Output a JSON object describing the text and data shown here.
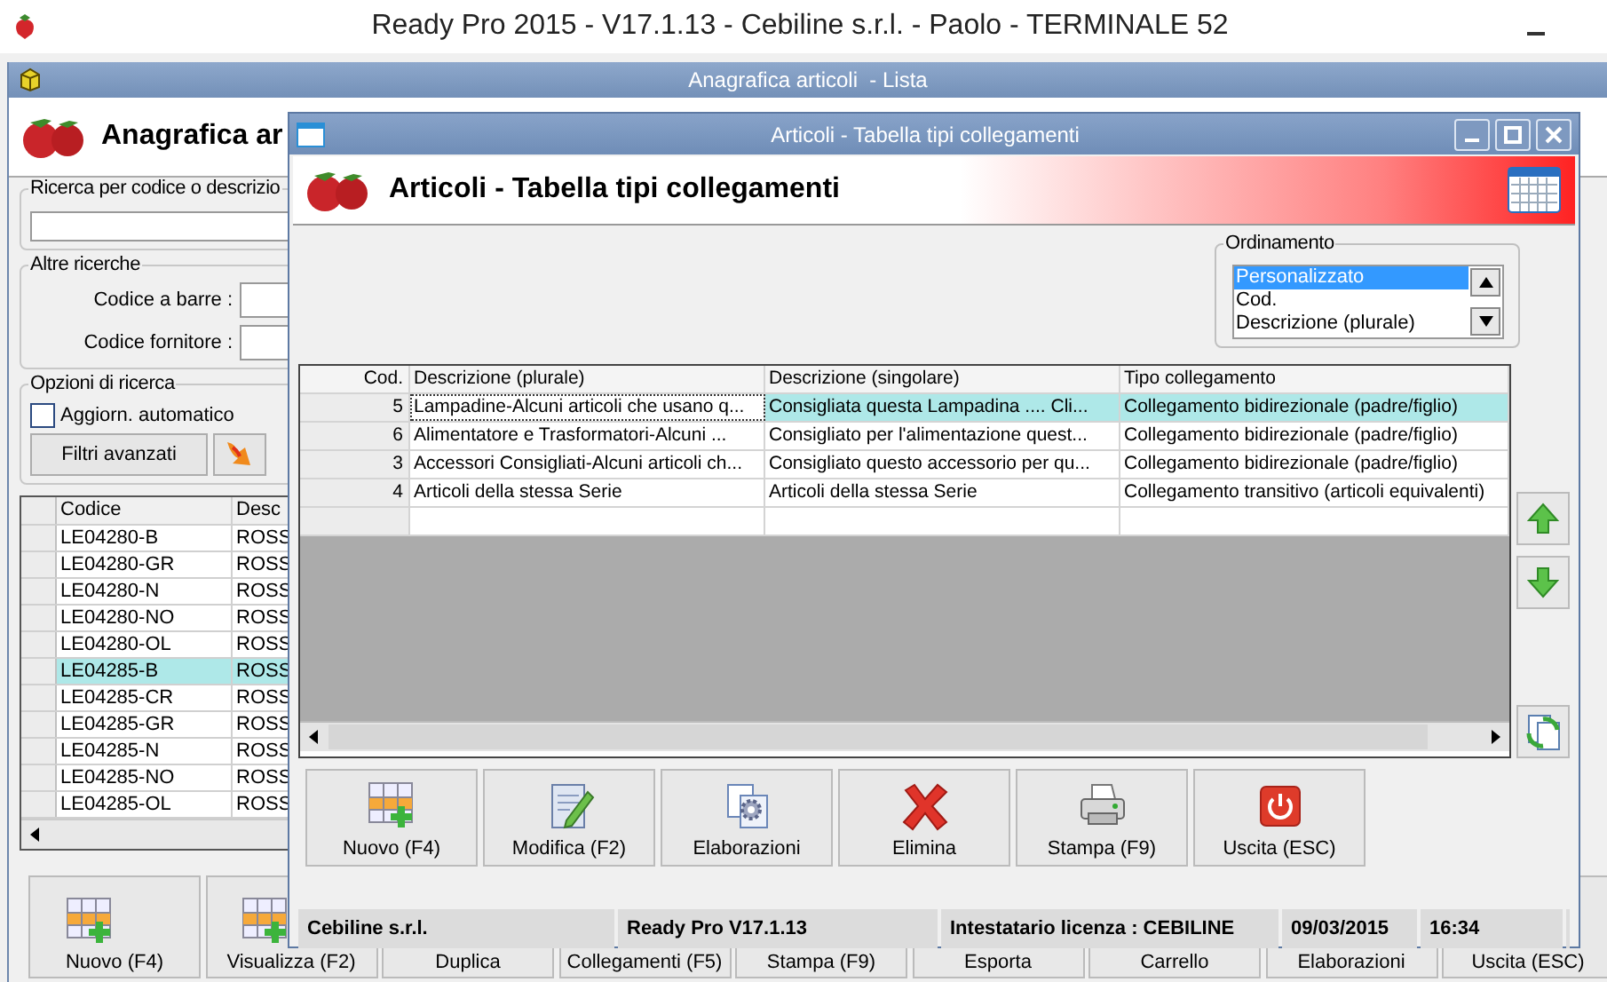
{
  "app_title": "Ready Pro 2015 - V17.1.13 - Cebiline s.r.l. - Paolo - TERMINALE 52",
  "list_window": {
    "title": "Anagrafica articoli  - Lista",
    "header": "Anagrafica ar",
    "search_group": "Ricerca per codice o descrizio",
    "other_group": "Altre ricerche",
    "other_fields": [
      {
        "label": "Codice a barre :"
      },
      {
        "label": "Codice fornitore :"
      }
    ],
    "options_group": "Opzioni di ricerca",
    "auto_update": {
      "label": "Aggiorn. automatico",
      "checked": false
    },
    "filter_button": "Filtri avanzati",
    "grid": {
      "columns": [
        "Codice",
        "Desc"
      ],
      "rows": [
        {
          "code": "LE04280-B",
          "desc": "ROSS",
          "selected": false
        },
        {
          "code": "LE04280-GR",
          "desc": "ROSS",
          "selected": false
        },
        {
          "code": "LE04280-N",
          "desc": "ROSS",
          "selected": false
        },
        {
          "code": "LE04280-NO",
          "desc": "ROSS",
          "selected": false
        },
        {
          "code": "LE04280-OL",
          "desc": "ROSS",
          "selected": false
        },
        {
          "code": "LE04285-B",
          "desc": "ROSS",
          "selected": true
        },
        {
          "code": "LE04285-CR",
          "desc": "ROSS",
          "selected": false
        },
        {
          "code": "LE04285-GR",
          "desc": "ROSS",
          "selected": false
        },
        {
          "code": "LE04285-N",
          "desc": "ROSS",
          "selected": false
        },
        {
          "code": "LE04285-NO",
          "desc": "ROSS",
          "selected": false
        },
        {
          "code": "LE04285-OL",
          "desc": "ROSS",
          "selected": false
        }
      ]
    },
    "buttons": [
      {
        "label": "Nuovo (F4)",
        "kind": "icon"
      },
      {
        "label": "Visualizza (F2)",
        "kind": "icon"
      },
      {
        "label": "Duplica",
        "kind": "plain"
      },
      {
        "label": "Collegamenti (F5)",
        "kind": "plain"
      },
      {
        "label": "Stampa (F9)",
        "kind": "plain"
      },
      {
        "label": "Esporta",
        "kind": "plain"
      },
      {
        "label": "Carrello",
        "kind": "plain"
      },
      {
        "label": "Elaborazioni",
        "kind": "plain"
      },
      {
        "label": "Uscita (ESC)",
        "kind": "plain"
      }
    ]
  },
  "dialog": {
    "title": "Articoli - Tabella tipi collegamenti",
    "header": "Articoli - Tabella tipi collegamenti",
    "ordering": {
      "label": "Ordinamento",
      "options": [
        {
          "label": "Personalizzato",
          "selected": true
        },
        {
          "label": "Cod.",
          "selected": false
        },
        {
          "label": "Descrizione (plurale)",
          "selected": false
        }
      ]
    },
    "table": {
      "columns": [
        "Cod.",
        "Descrizione (plurale)",
        "Descrizione (singolare)",
        "Tipo collegamento"
      ],
      "rows": [
        {
          "cells": [
            "5",
            "Lampadine-Alcuni articoli che usano q...",
            "Consigliata questa Lampadina .... Cli...",
            "Collegamento bidirezionale (padre/figlio)"
          ],
          "selected": true
        },
        {
          "cells": [
            "6",
            "Alimentatore e Trasformatori-Alcuni ...",
            "Consigliato per l'alimentazione quest...",
            "Collegamento bidirezionale (padre/figlio)"
          ],
          "selected": false
        },
        {
          "cells": [
            "3",
            "Accessori Consigliati-Alcuni articoli ch...",
            "Consigliato questo accessorio per qu...",
            "Collegamento bidirezionale (padre/figlio)"
          ],
          "selected": false
        },
        {
          "cells": [
            "4",
            "Articoli della stessa Serie",
            "Articoli della stessa Serie",
            "Collegamento transitivo (articoli equivalenti)"
          ],
          "selected": false
        }
      ]
    },
    "buttons": [
      {
        "label": "Nuovo (F4)",
        "kind": "new"
      },
      {
        "label": "Modifica (F2)",
        "kind": "edit"
      },
      {
        "label": "Elaborazioni",
        "kind": "process"
      },
      {
        "label": "Elimina",
        "kind": "delete"
      },
      {
        "label": "Stampa (F9)",
        "kind": "print"
      },
      {
        "label": "Uscita (ESC)",
        "kind": "exit"
      }
    ],
    "status_bar": [
      "Cebiline s.r.l.",
      "Ready Pro V17.1.13",
      "Intestatario licenza : CEBILINE",
      "09/03/2015",
      "16:34"
    ]
  }
}
